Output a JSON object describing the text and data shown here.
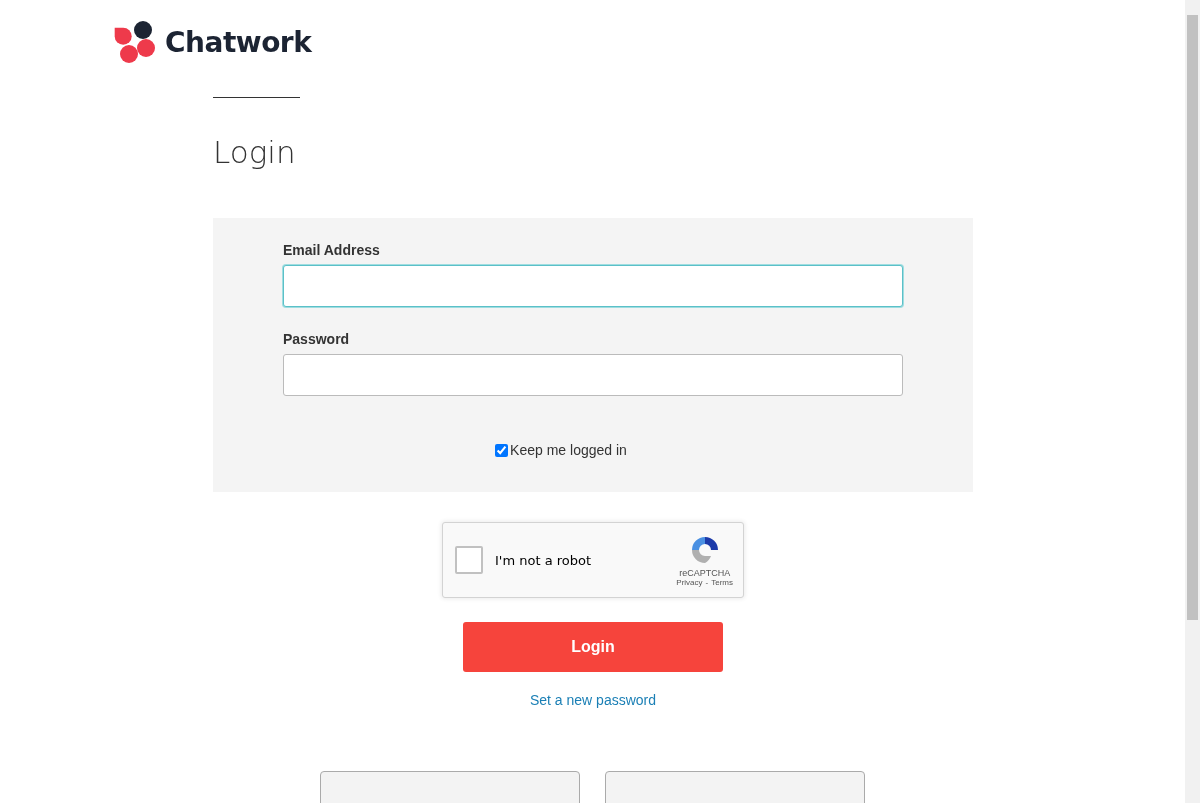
{
  "logo": {
    "text": "Chatwork"
  },
  "heading": "Login",
  "form": {
    "fields": [
      {
        "label": "Email Address",
        "focused": true
      },
      {
        "label": "Password",
        "focused": false
      }
    ],
    "remember": {
      "label": "Keep me logged in",
      "checked": true
    }
  },
  "captcha": {
    "label": "I'm not a robot",
    "checked": false,
    "brand": "reCAPTCHA",
    "privacy": "Privacy",
    "separator": "-",
    "terms": "Terms"
  },
  "submit": "Login",
  "reset_link": "Set a new password"
}
